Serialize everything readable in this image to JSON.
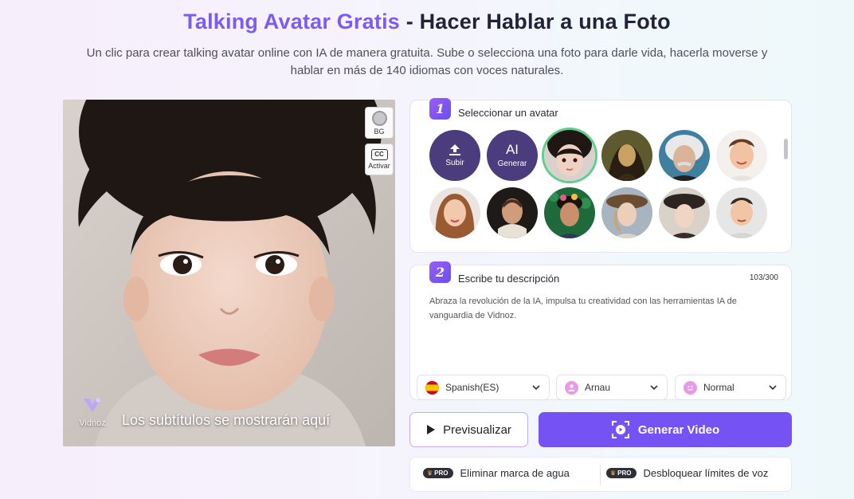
{
  "header": {
    "title_highlight": "Talking Avatar Gratis",
    "title_rest": " - Hacer Hablar a una Foto",
    "subtitle": "Un clic para crear talking avatar online con IA de manera gratuita. Sube o selecciona una foto para darle vida, hacerla moverse y hablar en más de 140 idiomas con voces naturales."
  },
  "preview": {
    "bg_label": "BG",
    "cc_label": "CC",
    "activate_label": "Activar",
    "caption": "Los subtítulos se mostrarán aquí",
    "watermark": "Vidnoz"
  },
  "step1": {
    "number": "1",
    "title": "Seleccionar un avatar",
    "upload_label": "Subir",
    "ai_label": "AI",
    "generate_label": "Generar"
  },
  "step2": {
    "number": "2",
    "title": "Escribe tu descripción",
    "counter": "103/300",
    "text": "Abraza la revolución de la IA, impulsa tu creatividad con las herramientas IA de vanguardia de Vidnoz.",
    "language": "Spanish(ES)",
    "voice": "Arnau",
    "style": "Normal"
  },
  "actions": {
    "preview_label": "Previsualizar",
    "generate_label": "Generar Video"
  },
  "pro": {
    "tag": "PRO",
    "remove_watermark": "Eliminar marca de agua",
    "unlock_voice": "Desbloquear límites de voz"
  },
  "colors": {
    "accent": "#7452f3",
    "title_highlight": "#7a5cf2",
    "selected_ring": "#5fcf8a"
  }
}
